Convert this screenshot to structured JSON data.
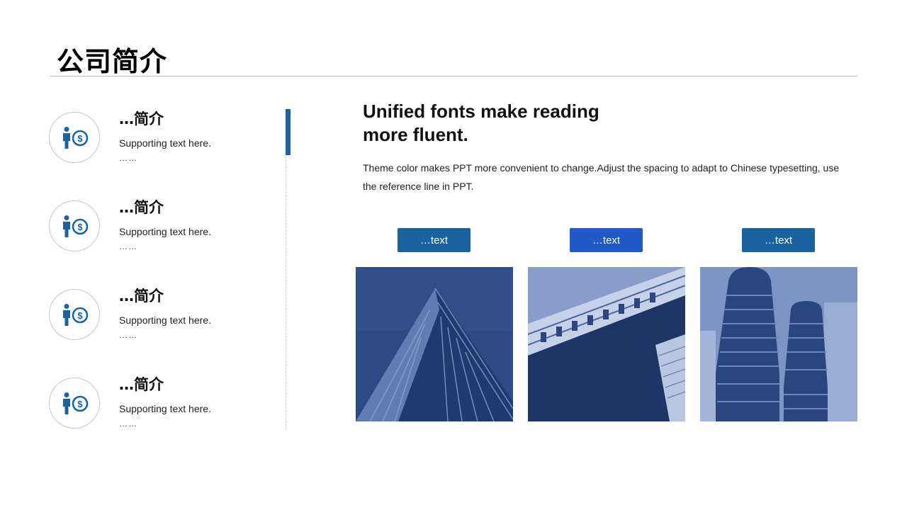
{
  "page": {
    "title": "公司简介"
  },
  "features": [
    {
      "title": "…简介",
      "text": "Supporting  text here.",
      "dots": "……"
    },
    {
      "title": "…简介",
      "text": "Supporting  text here.",
      "dots": "……"
    },
    {
      "title": "…简介",
      "text": "Supporting  text here.",
      "dots": "……"
    },
    {
      "title": "…简介",
      "text": "Supporting  text here.",
      "dots": "……"
    }
  ],
  "content": {
    "headline": "Unified  fonts  make  reading more fluent.",
    "body": "Theme color makes PPT more convenient  to change.Adjust  the  spacing  to adapt to Chinese  typesetting, use  the  reference  line  in  PPT."
  },
  "buttons": [
    {
      "label": "…text",
      "color": "#1a63a0"
    },
    {
      "label": "…text",
      "color": "#2159c9"
    },
    {
      "label": "…text",
      "color": "#1a63a0"
    }
  ],
  "theme": {
    "accent": "#1a63a0",
    "icon_color": "#1a63a0",
    "photo_tint": "#2b4a8a"
  },
  "icons": {
    "feature_icon": "person-dollar-icon"
  }
}
